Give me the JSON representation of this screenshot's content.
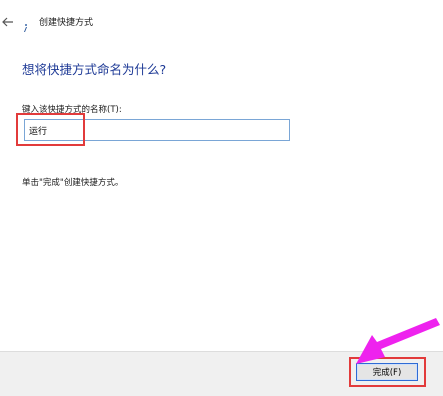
{
  "window": {
    "title": "创建快捷方式"
  },
  "content": {
    "heading": "想将快捷方式命名为什么?",
    "name_label": "键入该快捷方式的名称(T):",
    "name_value": "运行",
    "instruction": "单击\"完成\"创建快捷方式。"
  },
  "footer": {
    "finish_label": "完成(F)"
  },
  "annotations": {
    "highlight_color": "#e23b3b",
    "arrow_color": "#ee22ee"
  },
  "icons": {
    "back": "back-arrow-icon",
    "app": "shortcut-wizard-icon"
  }
}
